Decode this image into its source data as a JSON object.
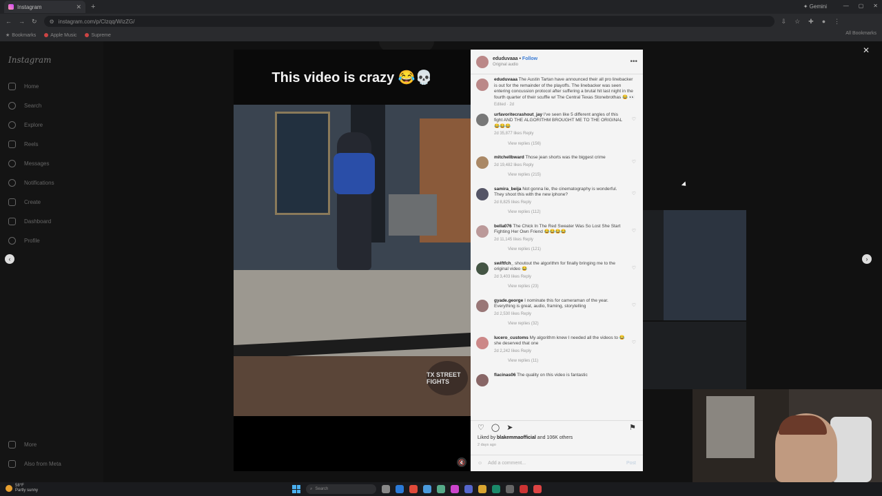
{
  "browser": {
    "tab_title": "Instagram",
    "address": "instagram.com/p/Clzqq/WizZG/",
    "gemini_label": "Gemini",
    "bookmarks": [
      "Bookmarks",
      "Apple Music",
      "Supreme"
    ],
    "all_bookmarks": "All Bookmarks"
  },
  "instagram": {
    "logo": "Instagram",
    "nav": [
      "Home",
      "Search",
      "Explore",
      "Reels",
      "Messages",
      "Notifications",
      "Create",
      "Dashboard",
      "Profile"
    ],
    "nav_bottom": [
      "More",
      "Also from Meta"
    ]
  },
  "video": {
    "caption": "This video is crazy 😂💀",
    "watermark": "TX STREET FIGHTS"
  },
  "post": {
    "author": "eduduvaaa",
    "follow_label": "Follow",
    "audio": "Original audio",
    "caption_user": "eduduvaaa",
    "caption_text": "The Austin Tartan have announced their all pro linebacker is out for the remainder of the playoffs. The linebacker was seen entering concussion protocol after suffering a brutal hit last night in the fourth quarter of their scuffle w/ The Central Texas Stonebrothas 😂 👀",
    "caption_meta": "Edited · 2d",
    "comments": [
      {
        "user": "urfavoritecrashout_jay",
        "text": "I've seen like 5 different angles of this fight AND THE ALGORITHM BROUGHT ME TO THE ORIGINAL 😂😂😂",
        "meta": "2d 35,877 likes Reply",
        "replies": "View replies (156)"
      },
      {
        "user": "mitchellbward",
        "text": "Those jean shorts was the biggest crime",
        "meta": "2d 19,482 likes Reply",
        "replies": "View replies (215)"
      },
      {
        "user": "samira_beija",
        "text": "Not gonna lie, the cinematography is wonderful. They shoot this with the new iphone?",
        "meta": "2d 8,825 likes Reply",
        "replies": "View replies (112)"
      },
      {
        "user": "bella076",
        "text": "The Chick In The Red Sweater Was So Lost She Start Fighting Her Own Friend 😂😂😂😂",
        "meta": "2d 11,145 likes Reply",
        "replies": "View replies (121)"
      },
      {
        "user": "swiftfch_",
        "text": "shoutout the algorithm for finally bringing me to the original video 😂",
        "meta": "2d 3,403 likes Reply",
        "replies": "View replies (23)"
      },
      {
        "user": "gyade.george",
        "text": "I nominate this for cameraman of the year. Everything is great, audio, framing, storytelling",
        "meta": "2d 2,530 likes Reply",
        "replies": "View replies (32)"
      },
      {
        "user": "lucero_customs",
        "text": "My algorithm knew I needed all the videos to 😂 she deserved that one",
        "meta": "2d 2,242 likes Reply",
        "replies": "View replies (11)"
      },
      {
        "user": "flacinas06",
        "text": "The quality on this video is fantastic",
        "meta": "",
        "replies": ""
      }
    ],
    "likes_prefix": "Liked by",
    "likes_user": "blakemmaofficial",
    "likes_suffix": "and 106K others",
    "date": "2 days ago",
    "add_comment_placeholder": "Add a comment...",
    "post_label": "Post"
  },
  "taskbar": {
    "temp": "58°F",
    "weather": "Partly sunny",
    "search_placeholder": "Search"
  }
}
